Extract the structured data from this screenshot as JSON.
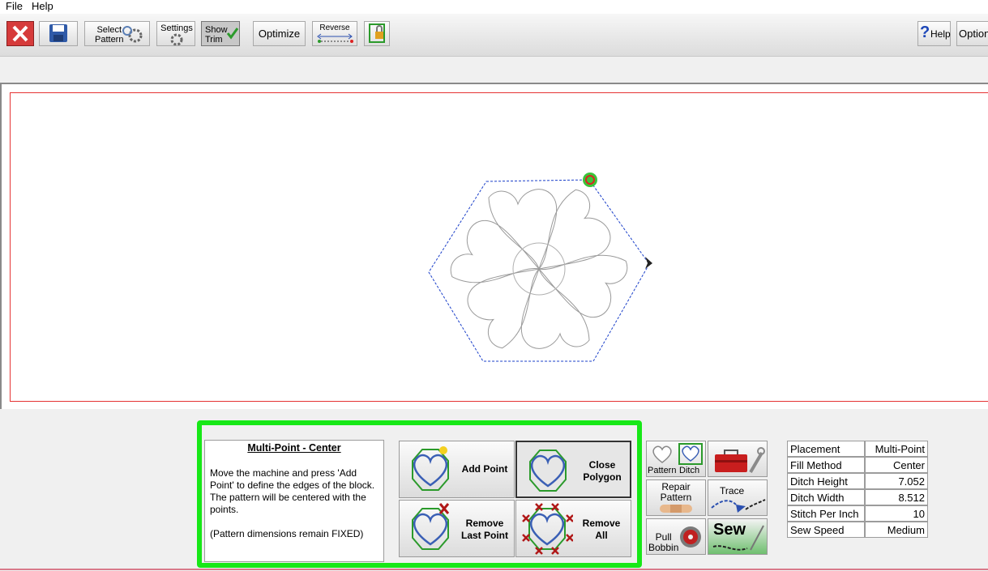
{
  "menu": [
    "File",
    "Help"
  ],
  "toolbar": {
    "select_pattern": [
      "Select",
      "Pattern"
    ],
    "settings": "Settings",
    "show_trim": [
      "Show",
      "Trim"
    ],
    "optimize": "Optimize",
    "reverse": "Reverse",
    "help": "Help",
    "options": "Options"
  },
  "panel": {
    "title": "Multi-Point - Center",
    "body": "Move the machine and press 'Add Point' to define the edges of the block. The pattern will be centered with the points.",
    "note": "(Pattern dimensions remain FIXED)"
  },
  "actions": {
    "add_point": "Add Point",
    "close_polygon": [
      "Close",
      "Polygon"
    ],
    "remove_last_point": [
      "Remove",
      "Last Point"
    ],
    "remove_all": [
      "Remove",
      "All"
    ]
  },
  "tools": {
    "pattern": "Pattern",
    "ditch": "Ditch",
    "repair_pattern": [
      "Repair",
      "Pattern"
    ],
    "trace": "Trace",
    "pull_bobbin": [
      "Pull",
      "Bobbin"
    ],
    "sew": "Sew"
  },
  "properties": [
    {
      "label": "Placement",
      "value": "Multi-Point"
    },
    {
      "label": "Fill Method",
      "value": "Center"
    },
    {
      "label": "Ditch Height",
      "value": "7.052"
    },
    {
      "label": "Ditch Width",
      "value": "8.512"
    },
    {
      "label": "Stitch Per Inch",
      "value": "10"
    },
    {
      "label": "Sew Speed",
      "value": "Medium"
    }
  ],
  "colors": {
    "accent_green": "#17e817",
    "border_red": "#e53333",
    "polygon_blue": "#1a3fc9"
  }
}
